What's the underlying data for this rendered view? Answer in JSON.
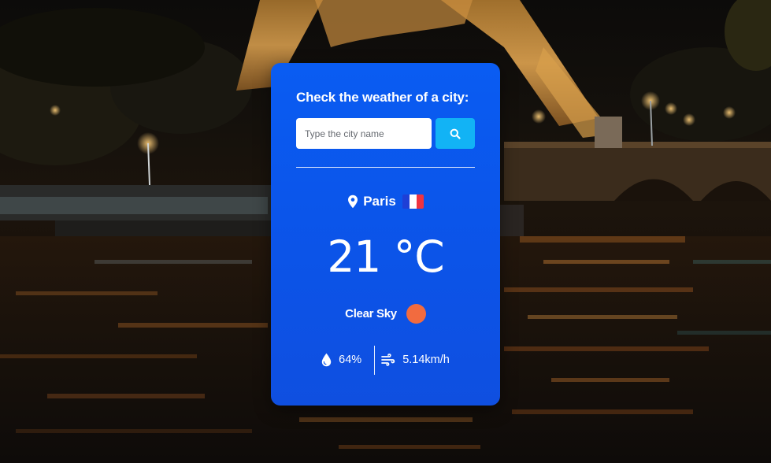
{
  "card": {
    "title": "Check the weather of a city:",
    "search": {
      "placeholder": "Type the city name",
      "value": "",
      "button_icon": "search-icon"
    },
    "location": {
      "icon": "map-pin-icon",
      "city": "Paris",
      "country_flag": "fr-flag"
    },
    "temperature": "21 °C",
    "condition": {
      "label": "Clear Sky",
      "icon": "sun-icon"
    },
    "humidity": {
      "icon": "water-drop-icon",
      "value": "64%"
    },
    "wind": {
      "icon": "wind-icon",
      "value": "5.14km/h"
    }
  },
  "colors": {
    "card_top": "#0a5cf2",
    "card_bottom": "#0f4fe0",
    "search_button": "#12b3f5",
    "sun": "#f26b3f",
    "flag_blue": "#1e3fd6",
    "flag_white": "#ffffff",
    "flag_red": "#ef3340"
  }
}
